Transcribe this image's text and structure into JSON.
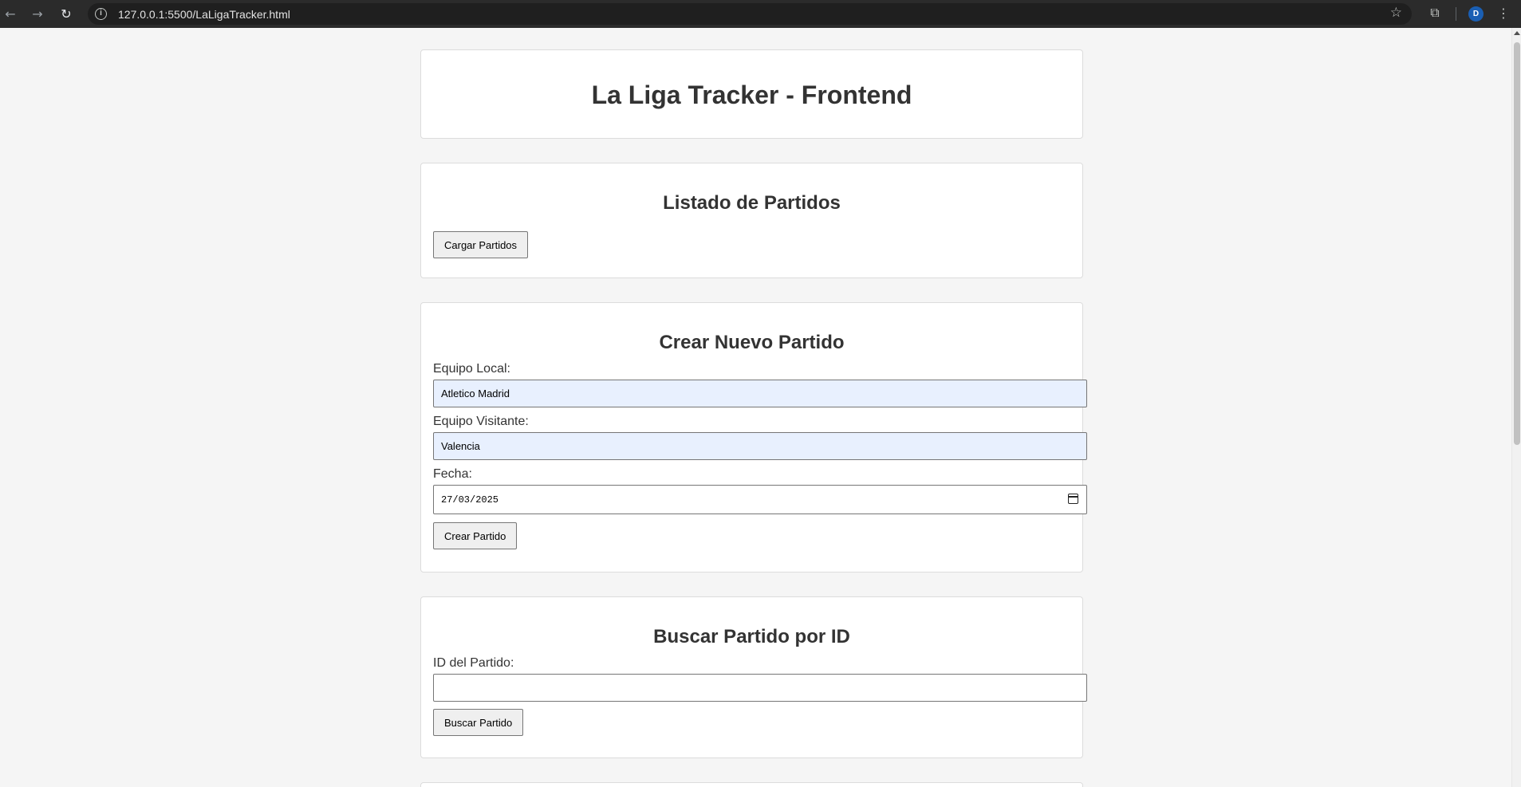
{
  "browser": {
    "back_icon": "←",
    "forward_icon": "→",
    "reload_icon": "↻",
    "url": "127.0.0.1:5500/LaLigaTracker.html",
    "star_icon": "☆",
    "extensions_icon": "⧉",
    "avatar_initial": "D",
    "menu_icon": "⋮"
  },
  "header": {
    "title": "La Liga Tracker - Frontend"
  },
  "list_section": {
    "title": "Listado de Partidos",
    "load_button": "Cargar Partidos"
  },
  "create_section": {
    "title": "Crear Nuevo Partido",
    "home_label": "Equipo Local:",
    "home_value": "Atletico Madrid",
    "away_label": "Equipo Visitante:",
    "away_value": "Valencia",
    "date_label": "Fecha:",
    "date_value": "27/03/2025",
    "create_button": "Crear Partido"
  },
  "search_section": {
    "title": "Buscar Partido por ID",
    "id_label": "ID del Partido:",
    "id_value": "",
    "search_button": "Buscar Partido"
  }
}
